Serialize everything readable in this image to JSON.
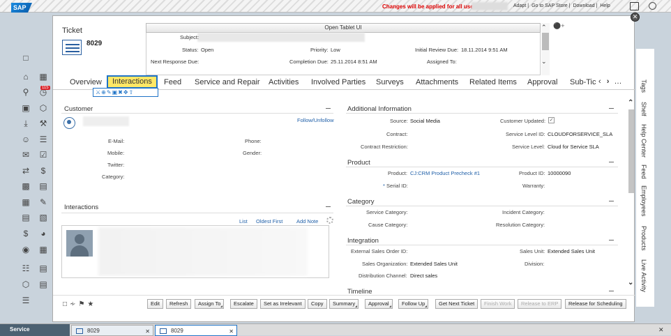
{
  "topbar": {
    "logo": "SAP",
    "warning": "Changes will be applied for all users",
    "links": [
      "Adapt",
      "Go to SAP Store",
      "Download",
      "Help"
    ]
  },
  "badge": "115",
  "right_tabs": [
    "Tags",
    "Shelf",
    "Help Center",
    "Feed",
    "Employees",
    "Products",
    "Live Activity"
  ],
  "header": {
    "title": "Ticket",
    "number": "8029",
    "tablet_button": "Open Tablet UI",
    "subject_label": "Subject:",
    "status_label": "Status:",
    "status_value": "Open",
    "priority_label": "Priority:",
    "priority_value": "Low",
    "initial_review_label": "Initial Review Due:",
    "initial_review_value": "18.11.2014 9:51 AM",
    "next_response_label": "Next Response Due:",
    "completion_label": "Completion Due:",
    "completion_value": "25.11.2014 8:51 AM",
    "assigned_label": "Assigned To:"
  },
  "tabs": [
    "Overview",
    "Interactions",
    "Feed",
    "Service and Repair",
    "Activities",
    "Involved Parties",
    "Surveys",
    "Attachments",
    "Related Items",
    "Approval",
    "Sub-Tic"
  ],
  "tab_tools": "⚔⊕✎▣✖✥⇧",
  "customer": {
    "title": "Customer",
    "follow": "Follow/Unfollow",
    "email_label": "E-Mail:",
    "phone_label": "Phone:",
    "mobile_label": "Mobile:",
    "gender_label": "Gender:",
    "twitter_label": "Twitter:",
    "category_label": "Category:"
  },
  "interactions": {
    "title": "Interactions",
    "list": "List",
    "oldest": "Oldest First",
    "add_note": "Add Note"
  },
  "additional": {
    "title": "Additional Information",
    "source_label": "Source:",
    "source_value": "Social Media",
    "customer_updated_label": "Customer Updated:",
    "contract_label": "Contract:",
    "service_level_id_label": "Service Level ID:",
    "service_level_id_value": "CLOUDFORSERVICE_SLA",
    "contract_restriction_label": "Contract Restriction:",
    "service_level_label": "Service Level:",
    "service_level_value": "Cloud for Service SLA"
  },
  "product": {
    "title": "Product",
    "product_label": "Product:",
    "product_value": "CJ:CRM Product Precheck #1",
    "product_id_label": "Product ID:",
    "product_id_value": "10000090",
    "serial_label": "Serial ID:",
    "warranty_label": "Warranty:"
  },
  "category": {
    "title": "Category",
    "service_label": "Service Category:",
    "incident_label": "Incident Category:",
    "cause_label": "Cause Category:",
    "resolution_label": "Resolution Category:"
  },
  "integration": {
    "title": "Integration",
    "ext_order_label": "External Sales Order ID:",
    "sales_unit_label": "Sales Unit:",
    "sales_unit_value": "Extended Sales Unit",
    "sales_org_label": "Sales Organization:",
    "sales_org_value": "Extended Sales Unit",
    "division_label": "Division:",
    "dist_channel_label": "Distribution Channel:",
    "dist_channel_value": "Direct sales"
  },
  "timeline": {
    "title": "Timeline"
  },
  "footer_buttons": [
    "Edit",
    "Refresh",
    "Assign To",
    "Escalate",
    "Set as Irrelevant",
    "Copy",
    "Summary",
    "Approval",
    "Follow Up",
    "Get Next Ticket",
    "Finish Work",
    "Release to ERP",
    "Release for Scheduling"
  ],
  "taskbar": {
    "service": "Service",
    "tab1": "8029",
    "tab2": "8029"
  }
}
